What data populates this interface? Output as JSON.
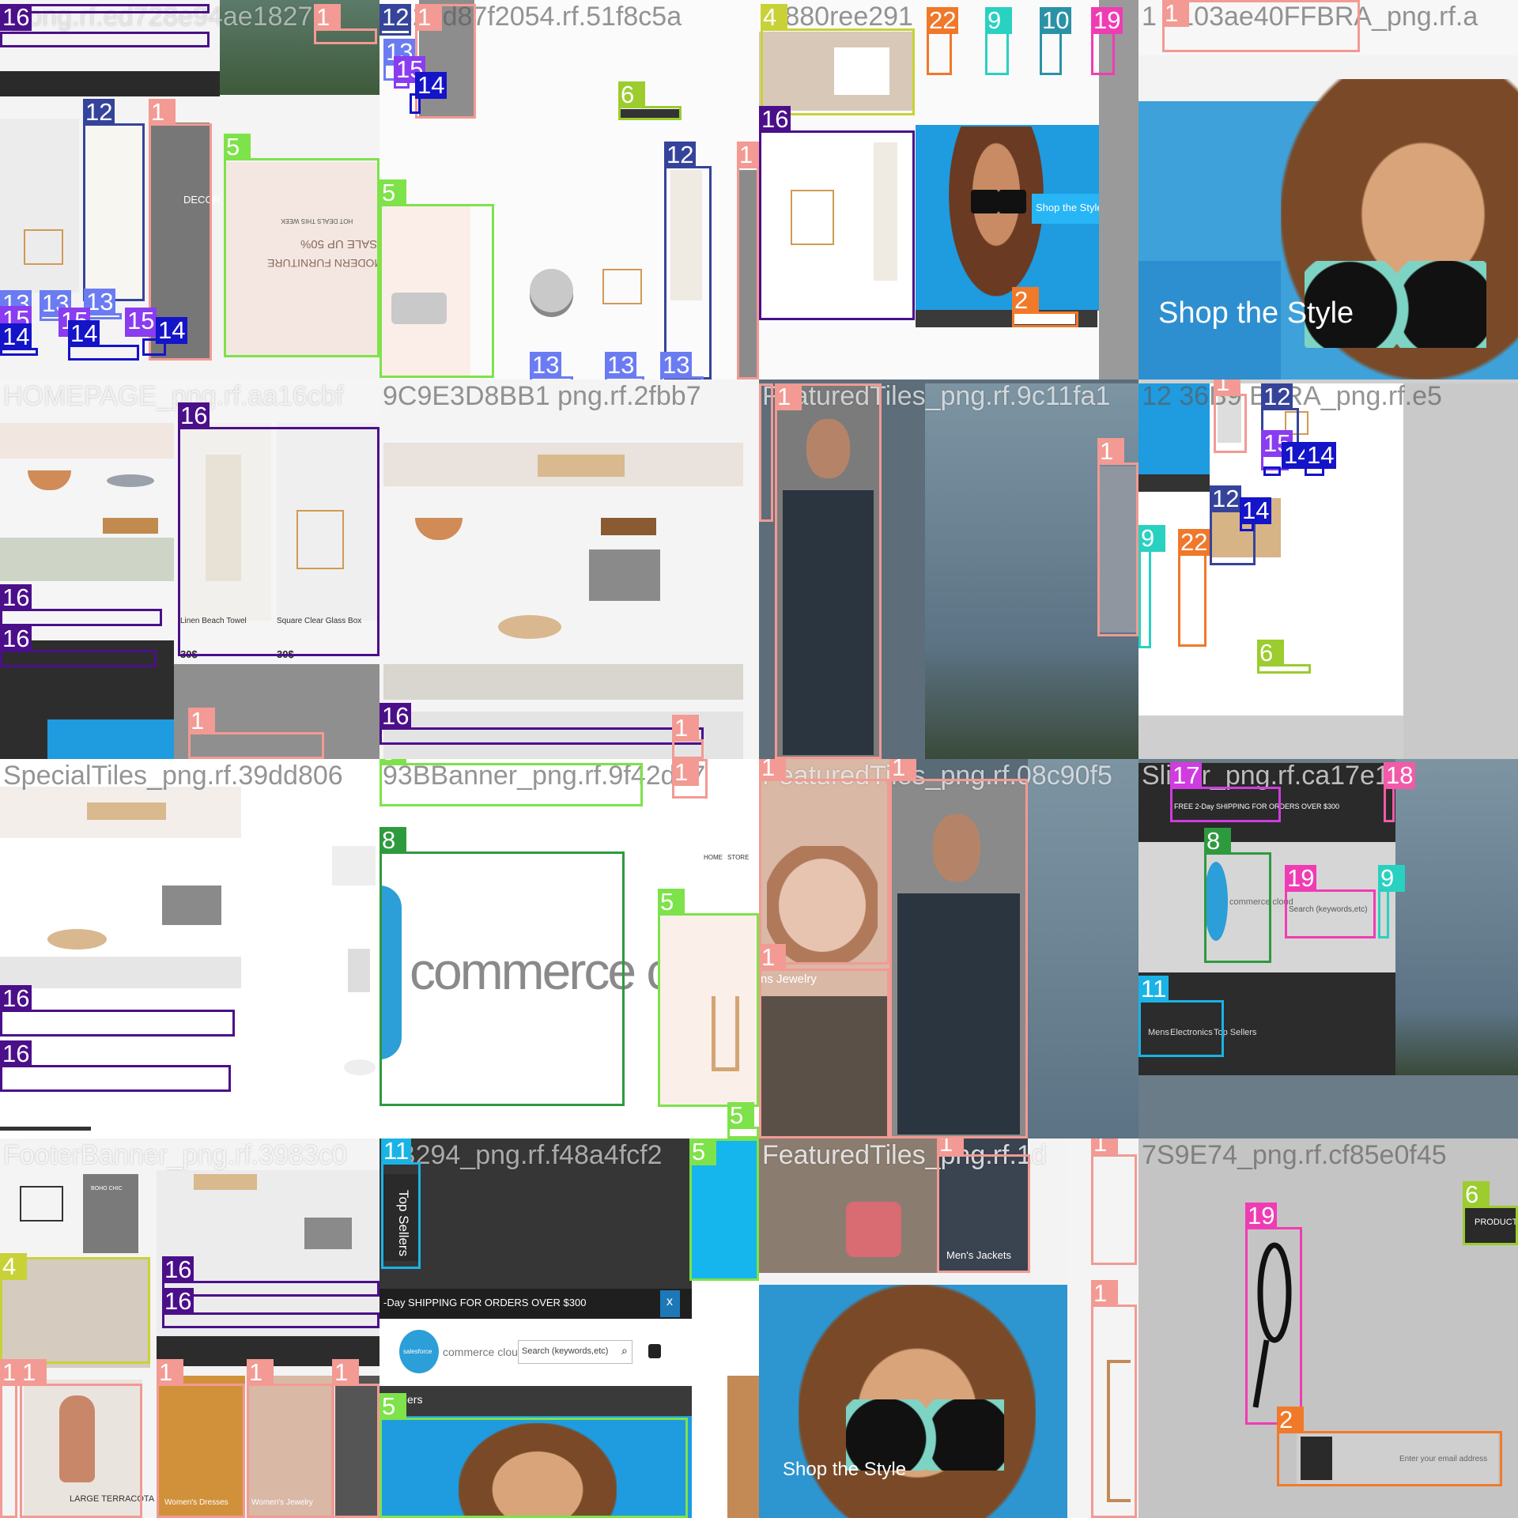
{
  "tiles": [
    {
      "name": "r_png.rf.ed728e94ae1827",
      "dark": false
    },
    {
      "name": "1629d87f2054.rf.51f8c5a",
      "dark": true
    },
    {
      "name": "4 880ree291",
      "dark": true
    },
    {
      "name": "1 0103ae40FFBRA_png.rf.a",
      "dark": true
    },
    {
      "name": "HOMEPAGE_png.rf.aa16cbf",
      "dark": false
    },
    {
      "name": "9C9E3D8BB1 png.rf.2fbb7",
      "dark": true
    },
    {
      "name": "FeaturedTiles_png.rf.9c11fa1",
      "dark": false
    },
    {
      "name": "12 36B9 BFRA_png.rf.e5",
      "dark": true
    },
    {
      "name": "SpecialTiles_png.rf.39dd806",
      "dark": true
    },
    {
      "name": "93BBanner_png.rf.9f42d17",
      "dark": true
    },
    {
      "name": "FeaturedTiles_png.rf.08c90f5",
      "dark": false
    },
    {
      "name": "Slider_png.rf.ca17e1a",
      "dark": false
    },
    {
      "name": "FooterBanner_png.rf.3983c0",
      "dark": false
    },
    {
      "name": "3B294_png.rf.f48a4fcf2",
      "dark": false
    },
    {
      "name": "FeaturedTiles_png.rf.1d",
      "dark": false
    },
    {
      "name": "7S9E74_png.rf.cf85e0f45",
      "dark": true
    }
  ],
  "labels": {
    "1": "1",
    "2": "2",
    "4": "4",
    "5": "5",
    "6": "6",
    "8": "8",
    "9": "9",
    "10": "10",
    "11": "11",
    "12": "12",
    "13": "13",
    "14": "14",
    "15": "15",
    "16": "16",
    "17": "17",
    "18": "18",
    "19": "19",
    "22": "22"
  },
  "texts": {
    "shop_the_style": "Shop the Style",
    "shop_the_style_small": "Shop the Style",
    "commerce_cloud": "commerce cloud",
    "commerce_cloud_small": "commerce cloud",
    "salesforce": "salesforce",
    "top_sellers": "Top Sellers",
    "top_sellers_bar": "p Sellers",
    "shipping": "-Day SHIPPING FOR ORDERS OVER $300",
    "shipping_small": "FREE 2-Day SHIPPING FOR ORDERS OVER $300",
    "search_placeholder": "Search (keywords,etc)",
    "search_small": "Search (keywords,etc)",
    "close_x": "x",
    "linen_towel": "Linen Beach Towel",
    "square_box": "Square Clear Glass Box",
    "price_30": "30$",
    "price_30b": "30$",
    "price_305": "30$",
    "mens_jackets": "Men's Jackets",
    "mens_jewelry": "ns Jewelry",
    "womens_dresses": "Women's Dresses",
    "womens_jewelry": "Women's Jewelry",
    "large_terracota": "LARGE TERRACOTA",
    "hot_deals": "HOT DEALS THIS WEEK",
    "sale_up": "SALE UP 50%",
    "modern_furniture": "MODERN FURNITURE",
    "decor": "DECOR",
    "nav_mens": "Mens",
    "nav_electronics": "Electronics",
    "nav_topsellers": "Top Sellers",
    "email_placeholder": "Enter your email address",
    "products": "PRODUCTS",
    "home": "HOME",
    "store": "STORE",
    "boho": "BOHO CHIC"
  }
}
